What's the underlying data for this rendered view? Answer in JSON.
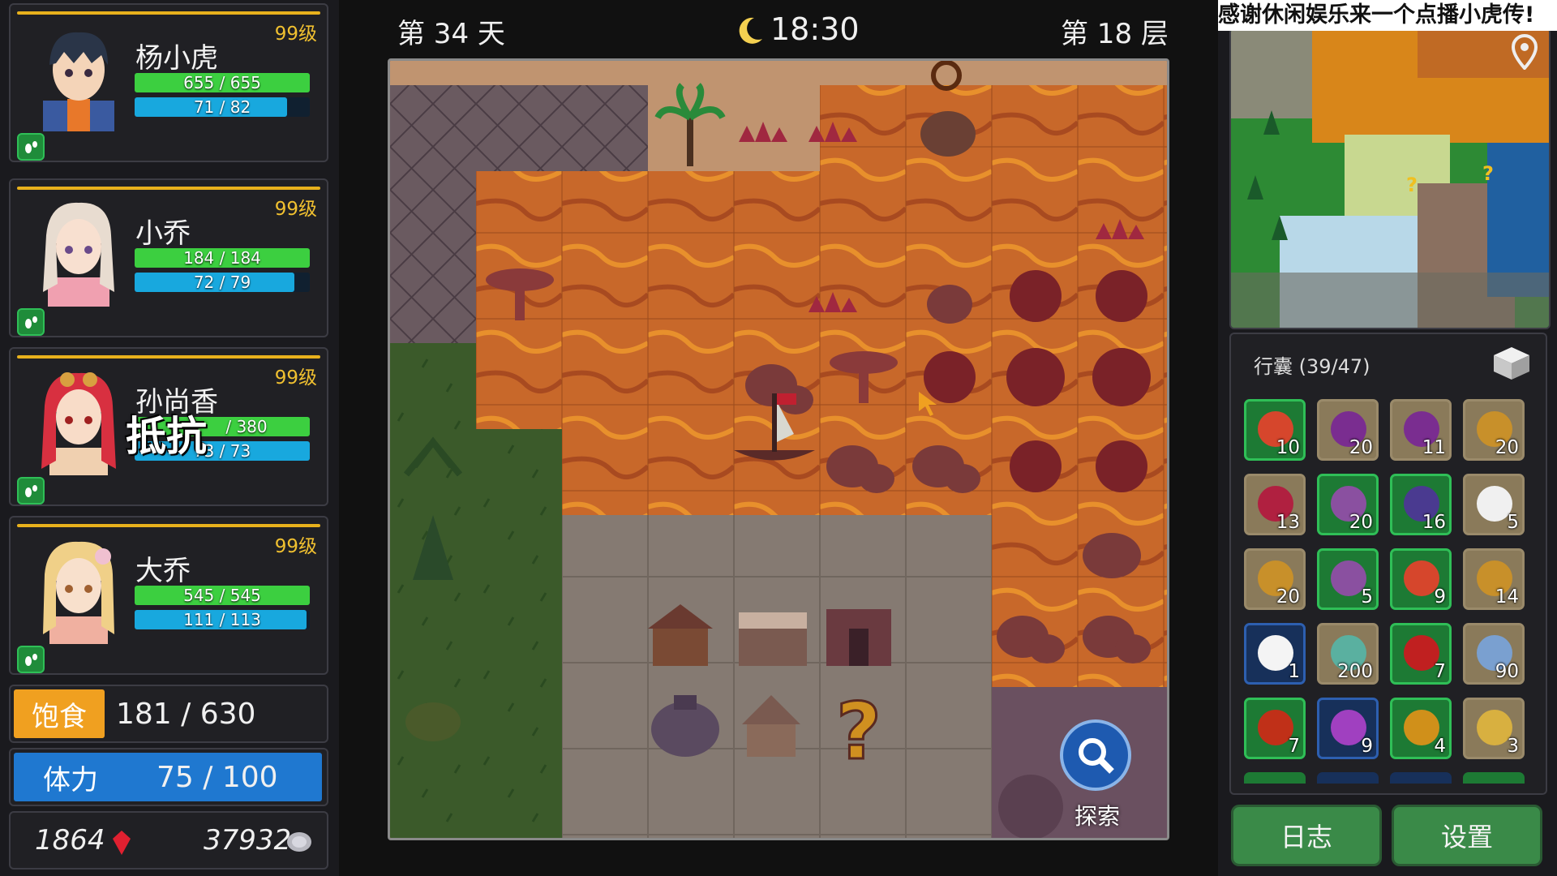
{
  "party": [
    {
      "name": "杨小虎",
      "level": "99级",
      "hp": "655 / 655",
      "hp_fill": 1.0,
      "mp": "71 / 82",
      "mp_fill": 0.87
    },
    {
      "name": "小乔",
      "level": "99级",
      "hp": "184 / 184",
      "hp_fill": 1.0,
      "mp": "72 / 79",
      "mp_fill": 0.91
    },
    {
      "name": "孙尚香",
      "level": "99级",
      "hp": "/ 380",
      "hp_fill": 1.0,
      "mp": "73 / 73",
      "mp_fill": 1.0,
      "overlay": "抵抗"
    },
    {
      "name": "大乔",
      "level": "99级",
      "hp": "545 / 545",
      "hp_fill": 1.0,
      "mp": "111 / 113",
      "mp_fill": 0.98
    }
  ],
  "stats": {
    "hunger_label": "饱食",
    "hunger_value": "181  / 630",
    "stamina_label": "体力",
    "stamina_value": "75  / 100"
  },
  "currency": {
    "gems": "1864",
    "coins": "37932"
  },
  "topbar": {
    "day": "第 34 天",
    "time": "18:30",
    "floor": "第 18 层"
  },
  "explore_label": "探索",
  "banner": "感谢休闲娱乐来一个点播小虎传!",
  "bag": {
    "title": "行囊 (39/47)",
    "items": [
      {
        "icon": "fruit-plate-icon",
        "count": "10",
        "color": "#d6462c",
        "border": "#2fbf57",
        "bg": "#1d7a34"
      },
      {
        "icon": "grape-icon",
        "count": "20",
        "color": "#7a2d90",
        "border": "#9a8a6a",
        "bg": "#8a7a5a"
      },
      {
        "icon": "grape-icon",
        "count": "11",
        "color": "#7a2d90",
        "border": "#9a8a6a",
        "bg": "#8a7a5a"
      },
      {
        "icon": "mixed-fruit-icon",
        "count": "20",
        "color": "#c8902a",
        "border": "#9a8a6a",
        "bg": "#8a7a5a"
      },
      {
        "icon": "berry-icon",
        "count": "13",
        "color": "#b02040",
        "border": "#9a8a6a",
        "bg": "#8a7a5a"
      },
      {
        "icon": "purple-berry-icon",
        "count": "20",
        "color": "#8a50a0",
        "border": "#2fbf57",
        "bg": "#1d7a34"
      },
      {
        "icon": "dark-plant-icon",
        "count": "16",
        "color": "#4a3a90",
        "border": "#2fbf57",
        "bg": "#1d7a34"
      },
      {
        "icon": "flower-icon",
        "count": "5",
        "color": "#f0f0f0",
        "border": "#9a8a6a",
        "bg": "#8a7a5a"
      },
      {
        "icon": "mixed-fruit-icon",
        "count": "20",
        "color": "#c8902a",
        "border": "#9a8a6a",
        "bg": "#8a7a5a"
      },
      {
        "icon": "purple-berry-icon",
        "count": "5",
        "color": "#8a50a0",
        "border": "#2fbf57",
        "bg": "#1d7a34"
      },
      {
        "icon": "fruit-plate-icon",
        "count": "9",
        "color": "#d6462c",
        "border": "#2fbf57",
        "bg": "#1d7a34"
      },
      {
        "icon": "mixed-fruit-icon",
        "count": "14",
        "color": "#c8902a",
        "border": "#9a8a6a",
        "bg": "#8a7a5a"
      },
      {
        "icon": "milk-icon",
        "count": "1",
        "color": "#f4f4f4",
        "border": "#2d5fb0",
        "bg": "#17305a"
      },
      {
        "icon": "seeds-icon",
        "count": "200",
        "color": "#5ab0a0",
        "border": "#9a8a6a",
        "bg": "#8a7a5a"
      },
      {
        "icon": "red-powder-icon",
        "count": "7",
        "color": "#c02020",
        "border": "#2fbf57",
        "bg": "#1d7a34"
      },
      {
        "icon": "blue-seeds-icon",
        "count": "90",
        "color": "#7aa0d0",
        "border": "#9a8a6a",
        "bg": "#8a7a5a"
      },
      {
        "icon": "red-fruit-icon",
        "count": "7",
        "color": "#c03018",
        "border": "#2fbf57",
        "bg": "#1d7a34"
      },
      {
        "icon": "purple-bar-icon",
        "count": "9",
        "color": "#a040c0",
        "border": "#2d5fb0",
        "bg": "#17305a"
      },
      {
        "icon": "corn-icon",
        "count": "4",
        "color": "#d0901a",
        "border": "#2fbf57",
        "bg": "#1d7a34"
      },
      {
        "icon": "cheese-icon",
        "count": "3",
        "color": "#d8b040",
        "border": "#9a8a6a",
        "bg": "#8a7a5a"
      }
    ]
  },
  "buttons": {
    "log": "日志",
    "settings": "设置"
  },
  "colors": {
    "hunger": "#f0a020",
    "stamina": "#1f78d0",
    "lava": "#c0642a",
    "grass": "#3b6a2a",
    "stone": "#8a8078"
  }
}
